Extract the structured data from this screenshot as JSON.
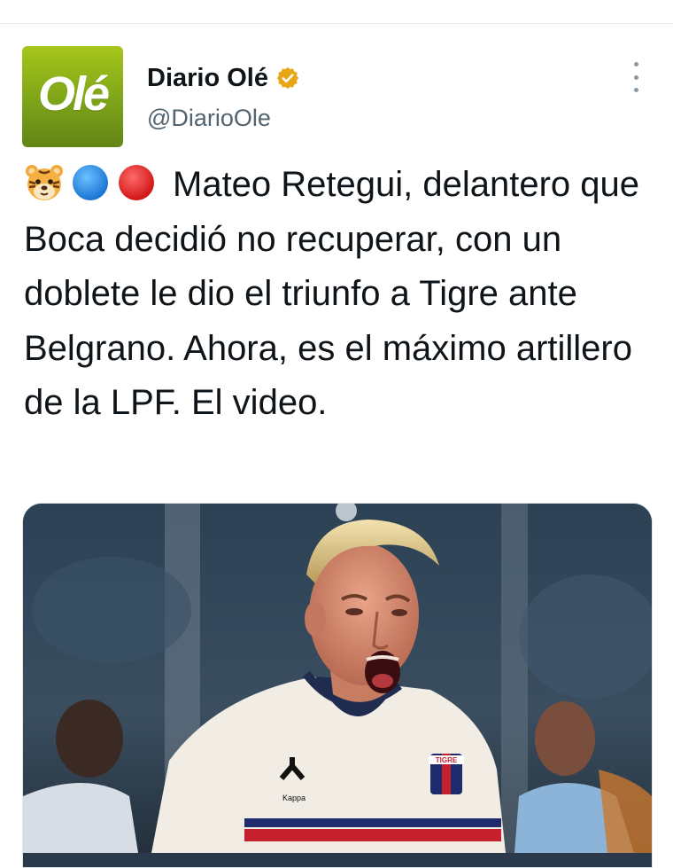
{
  "account": {
    "avatar_text": "Olé",
    "display_name": "Diario Olé",
    "handle": "@DiarioOle",
    "verified_icon": "verified-badge-icon",
    "verified_color": "#e8a617"
  },
  "tweet": {
    "emojis": [
      "tiger-face-icon",
      "blue-circle-icon",
      "red-circle-icon"
    ],
    "text": "Mateo Retegui, delantero que Boca decidió no recuperar, con un doblete le dio el triunfo a Tigre ante Belgrano. Ahora, es el máximo artillero de la LPF. El video."
  },
  "media": {
    "description": "photo",
    "jersey_badge_text": "TIGRE",
    "jersey_brand_text": "Kappa"
  },
  "colors": {
    "text": "#0f1419",
    "secondary": "#536471",
    "avatar_green": "#8bb21c"
  }
}
